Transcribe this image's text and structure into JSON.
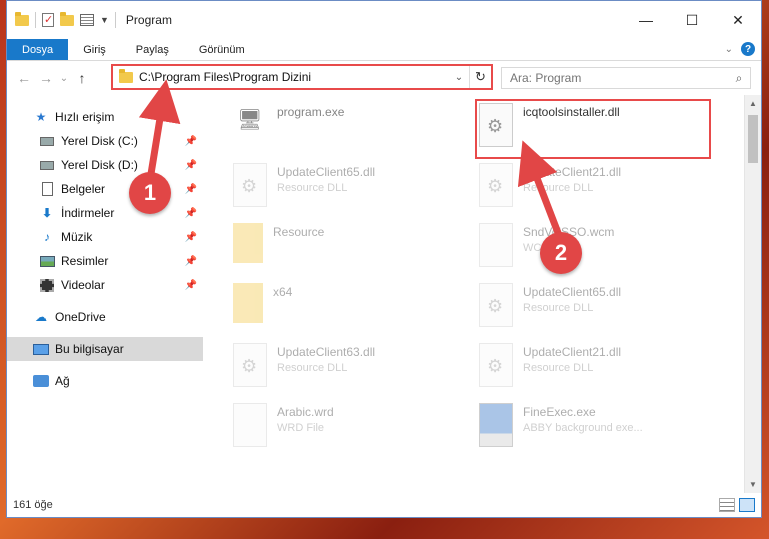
{
  "window": {
    "title": "Program",
    "controls": {
      "minimize": "—",
      "maximize": "☐",
      "close": "✕"
    }
  },
  "ribbon": {
    "tabs": [
      "Dosya",
      "Giriş",
      "Paylaş",
      "Görünüm"
    ],
    "help": "?"
  },
  "navbar": {
    "address_path": "C:\\Program Files\\Program Dizini",
    "search_placeholder": "Ara: Program"
  },
  "sidebar": {
    "quick_access": "Hızlı erişim",
    "quick_items": [
      {
        "label": "Yerel Disk (C:)",
        "icon": "drive-icon"
      },
      {
        "label": "Yerel Disk (D:)",
        "icon": "drive-icon"
      },
      {
        "label": "Belgeler",
        "icon": "documents-icon"
      },
      {
        "label": "İndirmeler",
        "icon": "downloads-icon"
      },
      {
        "label": "Müzik",
        "icon": "music-icon"
      },
      {
        "label": "Resimler",
        "icon": "pictures-icon"
      },
      {
        "label": "Videolar",
        "icon": "videos-icon"
      }
    ],
    "onedrive": "OneDrive",
    "this_pc": "Bu bilgisayar",
    "network": "Ağ"
  },
  "files": [
    {
      "name": "program.exe",
      "type": "",
      "icon": "setup-icon"
    },
    {
      "name": "icqtoolsinstaller.dll",
      "type": "",
      "icon": "dll-icon"
    },
    {
      "name": "UpdateClient65.dll",
      "type": "Resource DLL",
      "icon": "dll-icon"
    },
    {
      "name": "UpdateClient21.dll",
      "type": "Resource DLL",
      "icon": "dll-icon"
    },
    {
      "name": "Resource",
      "type": "",
      "icon": "folder-icon"
    },
    {
      "name": "SndVolSSO.wcm",
      "type": "WCM File",
      "icon": "file-icon"
    },
    {
      "name": "x64",
      "type": "",
      "icon": "folder-icon"
    },
    {
      "name": "UpdateClient65.dll",
      "type": "Resource DLL",
      "icon": "dll-icon"
    },
    {
      "name": "UpdateClient63.dll",
      "type": "Resource DLL",
      "icon": "dll-icon"
    },
    {
      "name": "UpdateClient21.dll",
      "type": "Resource DLL",
      "icon": "dll-icon"
    },
    {
      "name": "Arabic.wrd",
      "type": "WRD File",
      "icon": "file-icon"
    },
    {
      "name": "FineExec.exe",
      "type": "ABBY background exe...",
      "icon": "exe-icon"
    }
  ],
  "status": {
    "count": "161 öğe"
  },
  "annotations": {
    "badge1": "1",
    "badge2": "2"
  },
  "colors": {
    "accent": "#1979ca",
    "highlight": "#e84a4a"
  }
}
